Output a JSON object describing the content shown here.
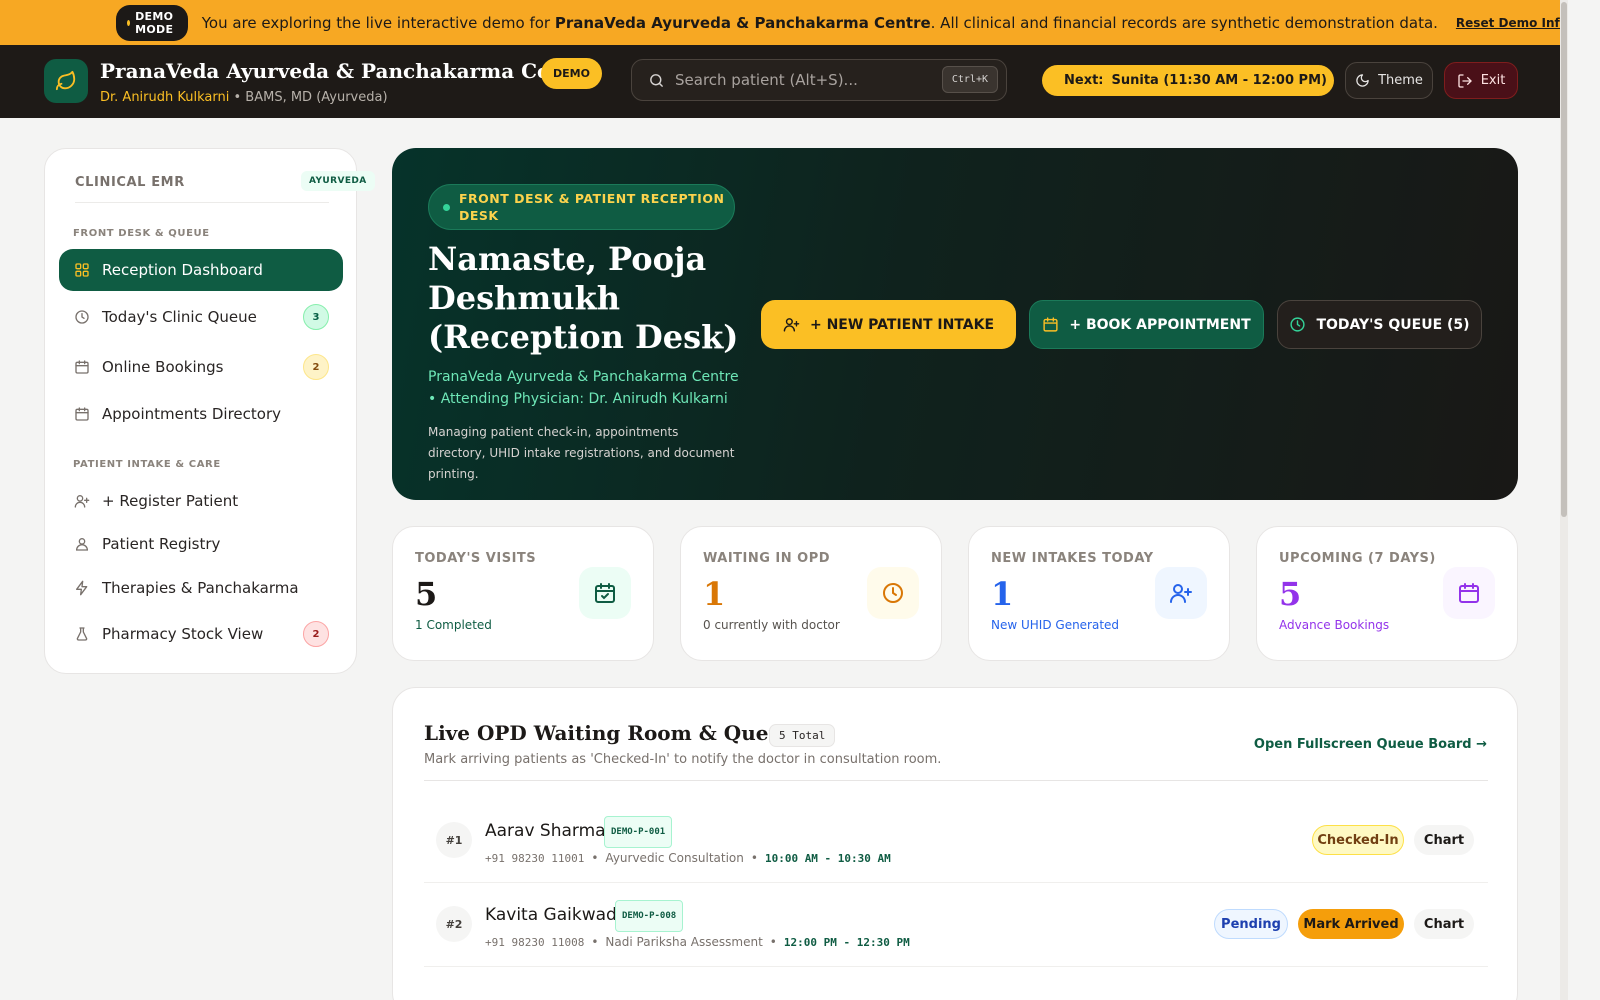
{
  "demo_banner": {
    "badge": "DEMO MODE",
    "text_prefix": "You are exploring the live interactive demo for ",
    "clinic_bold": "PranaVeda Ayurveda & Panchakarma Centre",
    "text_suffix": ". All clinical and financial records are synthetic demonstration data.",
    "reset_link": "Reset Demo Info"
  },
  "header": {
    "title": "PranaVeda Ayurveda & Panchakarma Centre",
    "demo_badge": "DEMO",
    "doctor_name": "Dr. Anirudh Kulkarni",
    "separator": "•",
    "doctor_qualifications": "BAMS, MD (Ayurveda)",
    "search_placeholder": "Search patient (Alt+S)...",
    "search_shortcut": "Ctrl+K",
    "next_prefix": "Next:",
    "next_value": "Sunita (11:30 AM - 12:00 PM)",
    "theme_label": "Theme",
    "exit_label": "Exit"
  },
  "sidebar": {
    "heading": "CLINICAL EMR",
    "badge": "AYURVEDA",
    "sections": [
      {
        "label": "FRONT DESK & QUEUE"
      },
      {
        "label": "PATIENT INTAKE & CARE"
      }
    ],
    "items": [
      {
        "label": "Reception Dashboard",
        "icon": "grid-icon",
        "active": true
      },
      {
        "label": "Today's Clinic Queue",
        "icon": "clock-icon",
        "count": "3"
      },
      {
        "label": "Online Bookings",
        "icon": "calendar-icon",
        "count": "2"
      },
      {
        "label": "Appointments Directory",
        "icon": "calendar-icon"
      },
      {
        "label": "+ Register Patient",
        "icon": "user-plus-icon"
      },
      {
        "label": "Patient Registry",
        "icon": "users-icon"
      },
      {
        "label": "Therapies & Panchakarma",
        "icon": "bolt-icon"
      },
      {
        "label": "Pharmacy Stock View",
        "icon": "flask-icon",
        "count": "2"
      }
    ]
  },
  "hero": {
    "pill": "FRONT DESK & PATIENT RECEPTION DESK",
    "title": "Namaste, Pooja Deshmukh (Reception Desk)",
    "subtitle": "PranaVeda Ayurveda & Panchakarma Centre • Attending Physician: Dr. Anirudh Kulkarni",
    "description": "Managing patient check-in, appointments directory, UHID intake registrations, and document printing.",
    "btn_intake": "+ NEW PATIENT INTAKE",
    "btn_book": "+ BOOK APPOINTMENT",
    "btn_queue": "TODAY'S QUEUE (5)"
  },
  "stats": [
    {
      "label": "TODAY'S VISITS",
      "value": "5",
      "sub": "1 Completed",
      "icon": "calendar-check-icon",
      "color": "#0f5c43"
    },
    {
      "label": "WAITING IN OPD",
      "value": "1",
      "sub": "0 currently with doctor",
      "icon": "clock-icon",
      "color": "#d97706"
    },
    {
      "label": "NEW INTAKES TODAY",
      "value": "1",
      "sub": "New UHID Generated",
      "icon": "user-plus-icon",
      "color": "#2563eb"
    },
    {
      "label": "UPCOMING (7 DAYS)",
      "value": "5",
      "sub": "Advance Bookings",
      "icon": "calendar-icon",
      "color": "#9333ea"
    }
  ],
  "queue": {
    "title": "Live OPD Waiting Room & Queue",
    "total": "5 Total",
    "subtitle": "Mark arriving patients as 'Checked-In' to notify the doctor in consultation room.",
    "fullscreen_link": "Open Fullscreen Queue Board →",
    "rows": [
      {
        "num": "#1",
        "name": "Aarav Sharma",
        "id": "DEMO-P-001",
        "phone": "+91 98230 11001",
        "type": "Ayurvedic Consultation",
        "time": "10:00 AM - 10:30 AM",
        "status": "Checked-In",
        "chart": "Chart"
      },
      {
        "num": "#2",
        "name": "Kavita Gaikwad",
        "id": "DEMO-P-008",
        "phone": "+91 98230 11008",
        "type": "Nadi Pariksha Assessment",
        "time": "12:00 PM - 12:30 PM",
        "status": "Pending",
        "action": "Mark Arrived",
        "chart": "Chart"
      }
    ]
  }
}
